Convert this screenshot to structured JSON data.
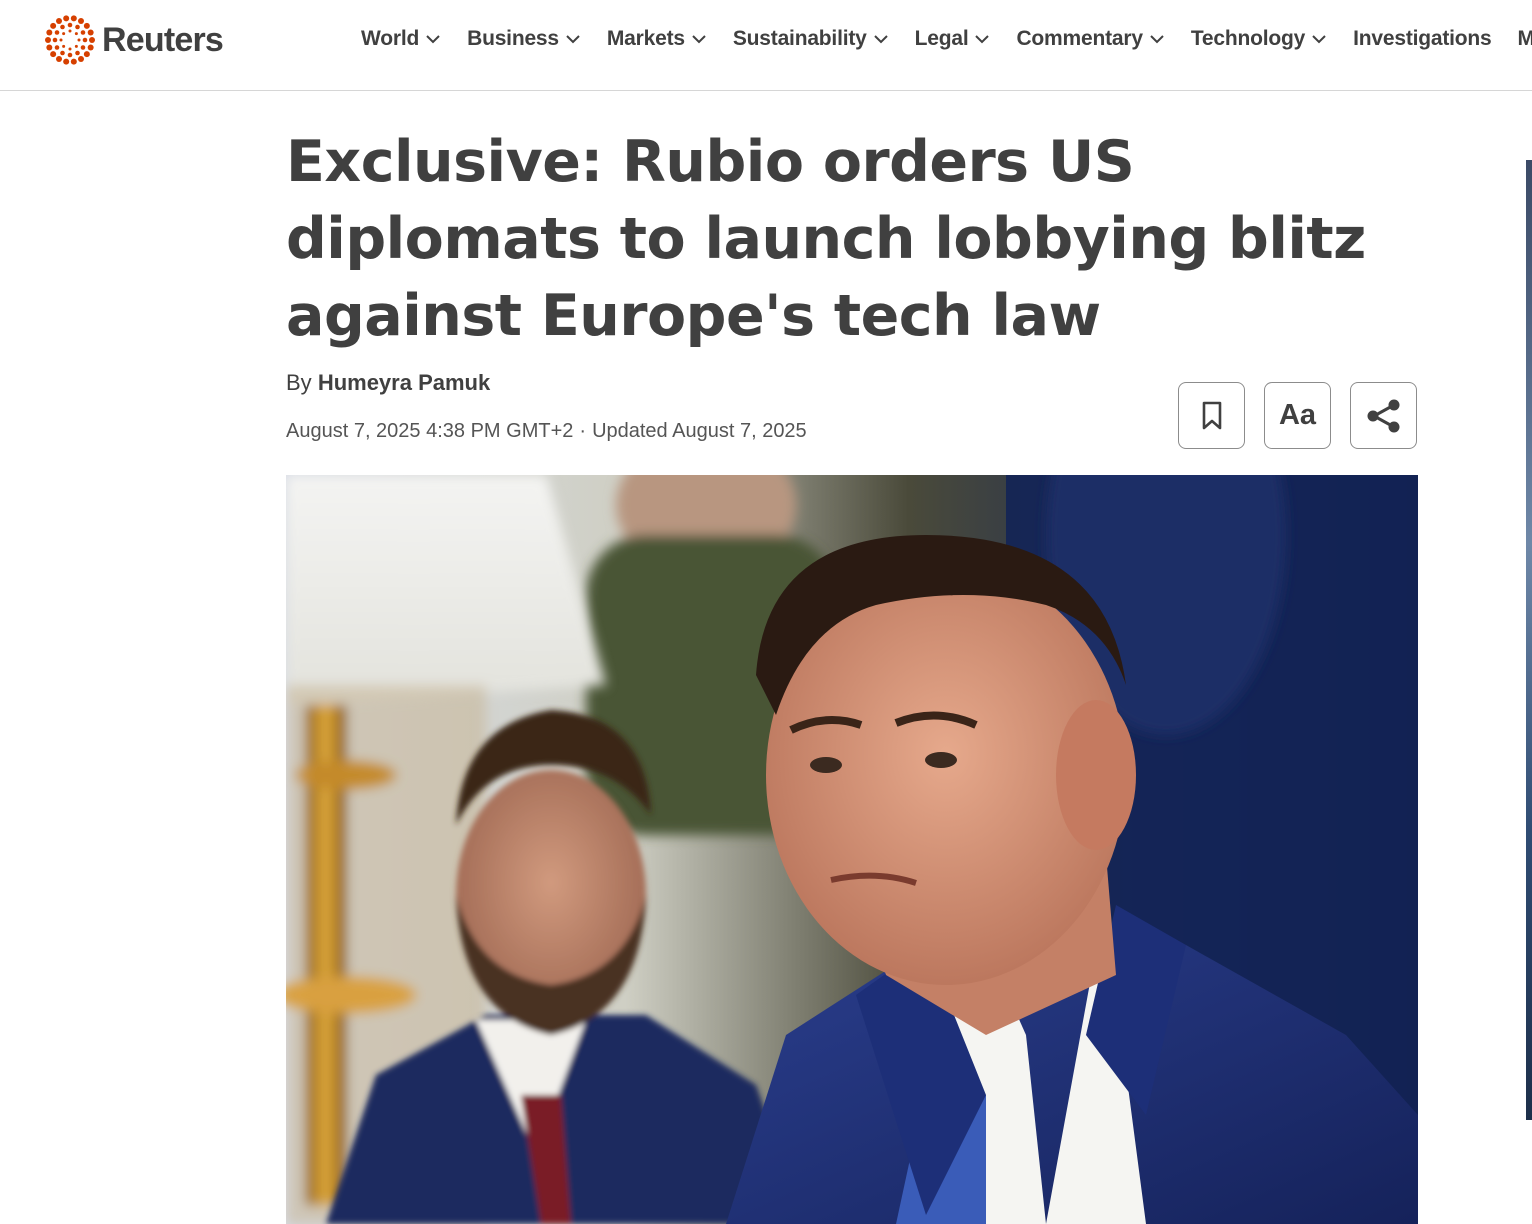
{
  "header": {
    "brand": "Reuters",
    "nav": [
      {
        "label": "World",
        "dropdown": true
      },
      {
        "label": "Business",
        "dropdown": true
      },
      {
        "label": "Markets",
        "dropdown": true
      },
      {
        "label": "Sustainability",
        "dropdown": true
      },
      {
        "label": "Legal",
        "dropdown": true
      },
      {
        "label": "Commentary",
        "dropdown": true
      },
      {
        "label": "Technology",
        "dropdown": true
      },
      {
        "label": "Investigations",
        "dropdown": false
      },
      {
        "label": "More",
        "dropdown": false
      }
    ]
  },
  "article": {
    "headline": "Exclusive: Rubio orders US diplomats to launch lobbying blitz against Europe's tech law",
    "byline_prefix": "By",
    "author": "Humeyra Pamuk",
    "published": "August 7, 2025 4:38 PM GMT+2",
    "separator": "·",
    "updated": "Updated August 7, 2025",
    "tools": {
      "bookmark_icon": "bookmark-icon",
      "text_size_label": "Aa",
      "share_icon": "share-icon"
    }
  },
  "colors": {
    "brand_orange": "#d64000",
    "text": "#404040",
    "divider": "#d6d6d6"
  }
}
